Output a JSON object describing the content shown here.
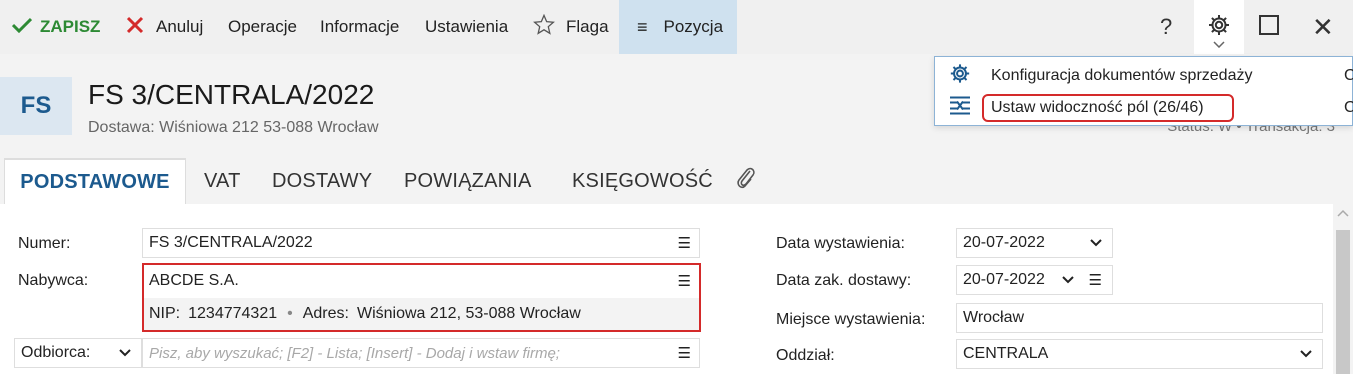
{
  "toolbar": {
    "save_label": "ZAPISZ",
    "cancel_label": "Anuluj",
    "operations_label": "Operacje",
    "information_label": "Informacje",
    "settings_label": "Ustawienia",
    "flag_label": "Flaga",
    "position_label": "Pozycja",
    "help_label": "?",
    "close_label": "✕",
    "colors": {
      "save": "#2d8a34",
      "cancel": "#d42a2a",
      "active_bg": "#cfe1ef"
    }
  },
  "header": {
    "badge": "FS",
    "title": "FS 3/CENTRALA/2022",
    "subtitle": "Dostawa: Wiśniowa 212 53-088 Wrocław",
    "status_text": "Status: W  •  Transakcja: 3"
  },
  "tabs": [
    {
      "label": "PODSTAWOWE"
    },
    {
      "label": "VAT"
    },
    {
      "label": "DOSTAWY"
    },
    {
      "label": "POWIĄZANIA"
    },
    {
      "label": "KSIĘGOWOŚĆ"
    }
  ],
  "form": {
    "number_label": "Numer:",
    "number_value": "FS 3/CENTRALA/2022",
    "buyer_label": "Nabywca:",
    "buyer_name": "ABCDE S.A.",
    "buyer_nip_label": "NIP:",
    "buyer_nip": "1234774321",
    "buyer_address_label": "Adres:",
    "buyer_address": "Wiśniowa 212, 53-088 Wrocław",
    "recipient_select": "Odbiorca:",
    "recipient_placeholder": "Pisz, aby wyszukać; [F2] - Lista; [Insert] - Dodaj i wstaw firmę;",
    "issue_date_label": "Data wystawienia:",
    "issue_date_value": "20-07-2022",
    "delivery_date_label": "Data zak. dostawy:",
    "delivery_date_value": "20-07-2022",
    "place_label": "Miejsce wystawienia:",
    "place_value": "Wrocław",
    "branch_label": "Oddział:",
    "branch_value": "CENTRALA"
  },
  "menu": {
    "items": [
      {
        "label": "Konfiguracja dokumentów sprzedaży",
        "key": "C",
        "icon": "gear-icon"
      },
      {
        "label": "Ustaw widoczność pól (26/46)",
        "key": "C",
        "icon": "field-visibility-icon"
      }
    ],
    "highlight_color": "#d42a2a"
  }
}
